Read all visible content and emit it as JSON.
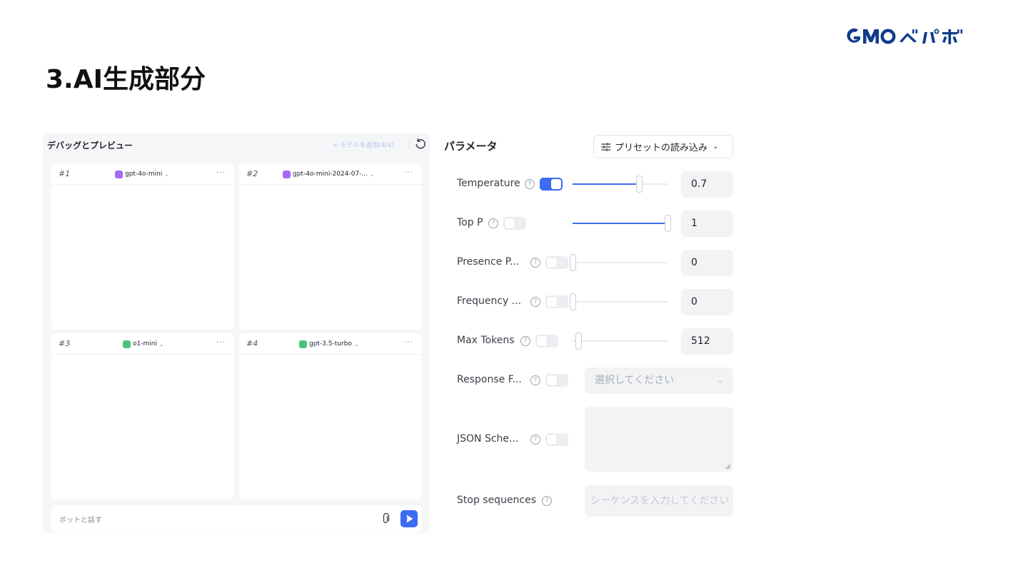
{
  "brand": {
    "logo_text": "GMOペパボ",
    "color": "#0f3c8c"
  },
  "slide": {
    "title": "3.AI生成部分"
  },
  "debug": {
    "title": "デバッグとプレビュー",
    "add_model": "+ モデルを追加(4/4)",
    "cards": [
      {
        "num": "#1",
        "model": "gpt-4o-mini",
        "icon_color": "#a569f5"
      },
      {
        "num": "#2",
        "model": "gpt-4o-mini-2024-07-...",
        "icon_color": "#a569f5"
      },
      {
        "num": "#3",
        "model": "o1-mini",
        "icon_color": "#4cc27a"
      },
      {
        "num": "#4",
        "model": "gpt-3.5-turbo",
        "icon_color": "#4cc27a"
      }
    ],
    "more": "···",
    "chev": "⌄",
    "input_placeholder": "ボットと話す"
  },
  "params": {
    "title": "パラメータ",
    "preset_label": "プリセットの読み込み",
    "preset_chev": "⌄",
    "help": "?",
    "temperature": {
      "label": "Temperature",
      "value": "0.7",
      "enabled": true,
      "level": 0.7
    },
    "top_p": {
      "label": "Top P",
      "value": "1",
      "enabled": false,
      "level": 1.0
    },
    "presence": {
      "label": "Presence P...",
      "value": "0",
      "enabled": false,
      "level": 0.0
    },
    "frequency": {
      "label": "Frequency ...",
      "value": "0",
      "enabled": false,
      "level": 0.0
    },
    "max_tokens": {
      "label": "Max Tokens",
      "value": "512",
      "enabled": false,
      "level": 0.0
    },
    "response_format": {
      "label": "Response F...",
      "placeholder": "選択してください",
      "chev": "⌄",
      "enabled": false
    },
    "json_schema": {
      "label": "JSON Sche...",
      "enabled": false
    },
    "stop_sequences": {
      "label": "Stop sequences",
      "placeholder": "シーケンスを入力してください"
    }
  },
  "colors": {
    "accent": "#3b6cf3",
    "panel_bg": "#f5f6f8",
    "field_bg": "#f2f3f5"
  }
}
